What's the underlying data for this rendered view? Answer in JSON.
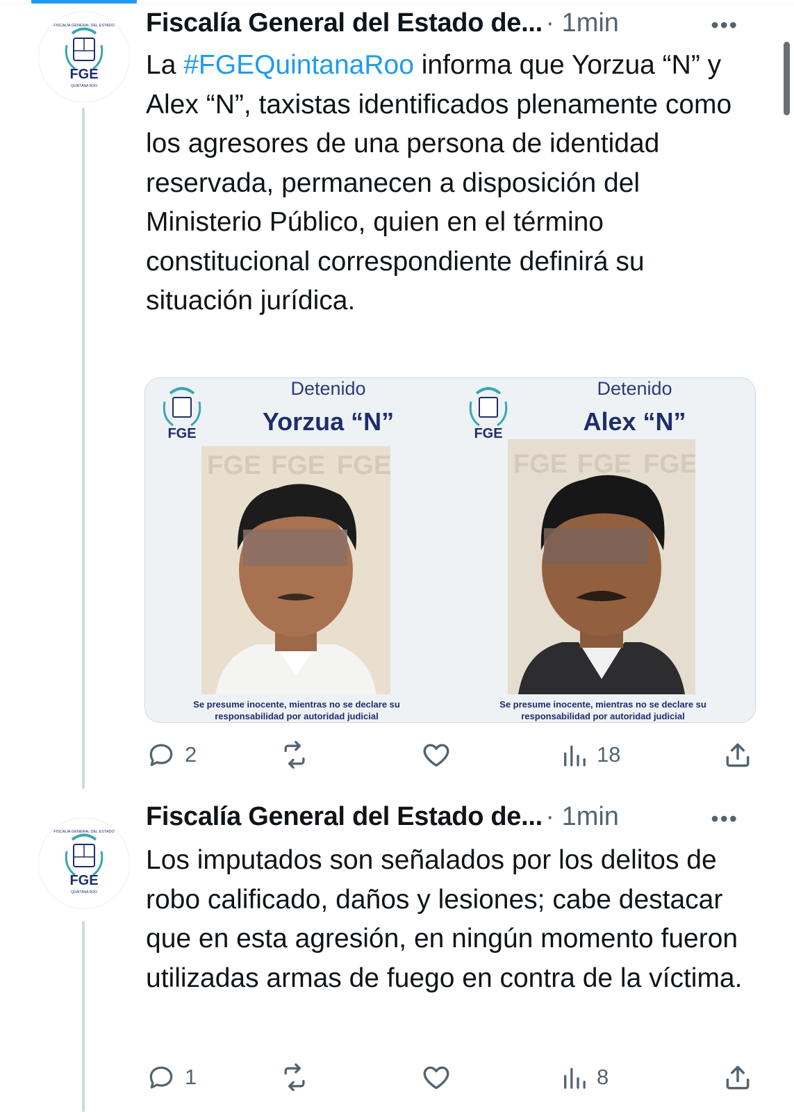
{
  "colors": {
    "link": "#1d9bf0",
    "text": "#0f1419",
    "muted": "#536471",
    "card_blue": "#1e2d6b"
  },
  "tweets": [
    {
      "author": "Fiscalía General del Estado de...",
      "separator": "·",
      "time": "1min",
      "more": "•••",
      "text_before": "La ",
      "hashtag": "#FGEQuintanaRoo",
      "text_after": " informa que Yorzua “N” y Alex “N”, taxistas identificados plenamente como los agresores de una persona de identidad reservada, permanecen a disposición del Ministerio Público, quien en el término constitucional correspondiente definirá su situación jurídica.",
      "media": [
        {
          "status": "Detenido",
          "name": "Yorzua “N”",
          "note": "Se presume inocente, mientras no se declare su responsabilidad por autoridad judicial",
          "logo": "FGE"
        },
        {
          "status": "Detenido",
          "name": "Alex “N”",
          "note": "Se presume inocente, mientras no se declare su responsabilidad por autoridad judicial",
          "logo": "FGE"
        }
      ],
      "actions": {
        "replies": "2",
        "retweets": "",
        "likes": "",
        "views": "18"
      }
    },
    {
      "author": "Fiscalía General del Estado de...",
      "separator": "·",
      "time": "1min",
      "more": "•••",
      "text": "Los imputados son señalados por los delitos de robo calificado, daños y lesiones; cabe destacar que en esta agresión, en ningún momento fueron utilizadas armas de fuego en contra de la víctima.",
      "actions": {
        "replies": "1",
        "retweets": "",
        "likes": "",
        "views": "8"
      }
    }
  ],
  "watermark": "FGE",
  "watermark_sub": "QUINTANA ROO",
  "avatar_logo": {
    "top_text": "FISCALÍA GENERAL DEL ESTADO",
    "mark": "FGE",
    "bottom_text": "QUINTANA ROO"
  }
}
